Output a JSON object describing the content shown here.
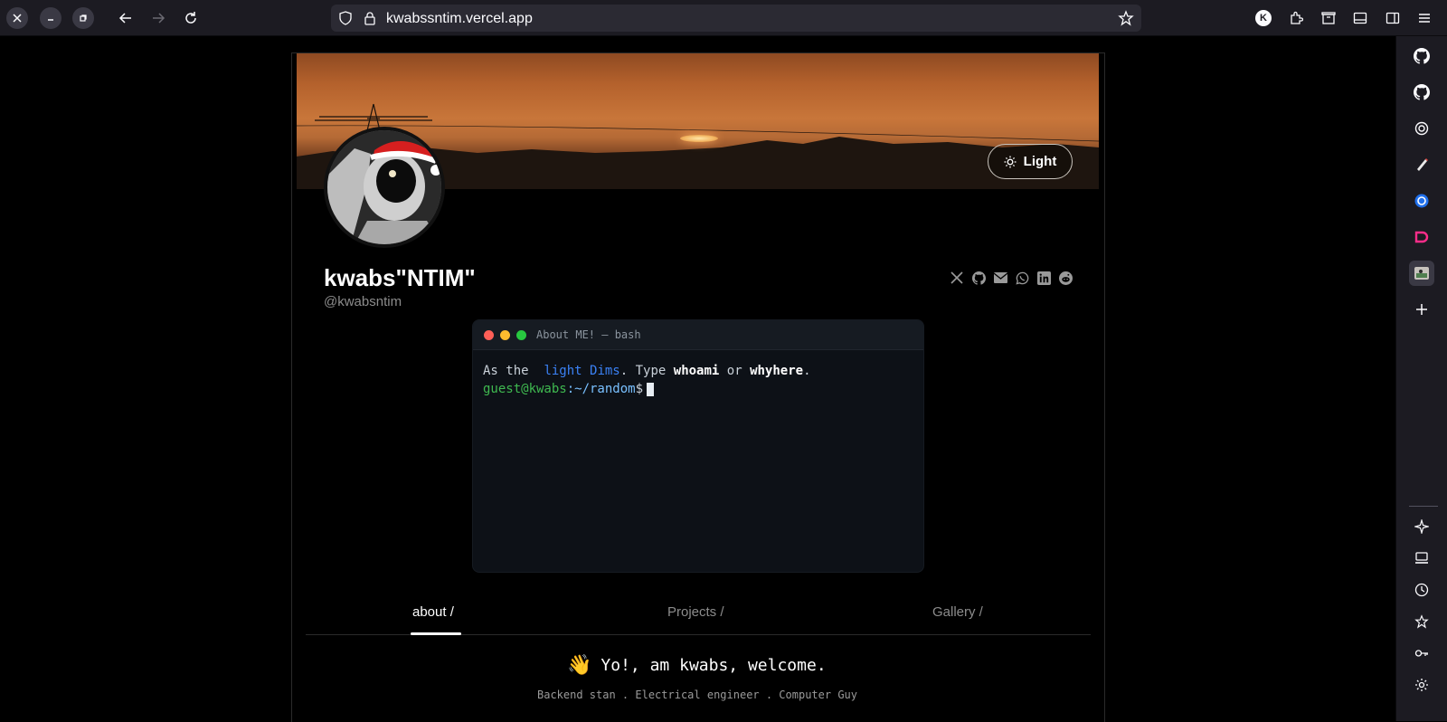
{
  "browser": {
    "url": "kwabssntim.vercel.app"
  },
  "profile": {
    "name": "kwabs\"NTIM\"",
    "handle": "@kwabsntim",
    "theme_button": "Light"
  },
  "socials": [
    "x-icon",
    "github-icon",
    "mail-icon",
    "whatsapp-icon",
    "linkedin-icon",
    "reddit-icon"
  ],
  "terminal": {
    "title": "About ME! — bash",
    "line1_prefix": "As the ",
    "line1_highlight": "light Dims",
    "line1_mid": ". Type ",
    "cmd1": "whoami",
    "or": " or ",
    "cmd2": "whyhere",
    "period": ".",
    "prompt_user": "guest@kwabs",
    "prompt_path": ":~/random",
    "prompt_symbol": "$"
  },
  "tabs": {
    "about": "about /",
    "projects": "Projects /",
    "gallery": "Gallery /"
  },
  "welcome": {
    "emoji": "👋",
    "text": "Yo!, am kwabs, welcome.",
    "subtitle": "Backend stan . Electrical engineer . Computer Guy"
  },
  "colors": {
    "accent_blue": "#3b82f6",
    "prompt_green": "#3fb950",
    "terminal_bg": "#0d1117"
  }
}
